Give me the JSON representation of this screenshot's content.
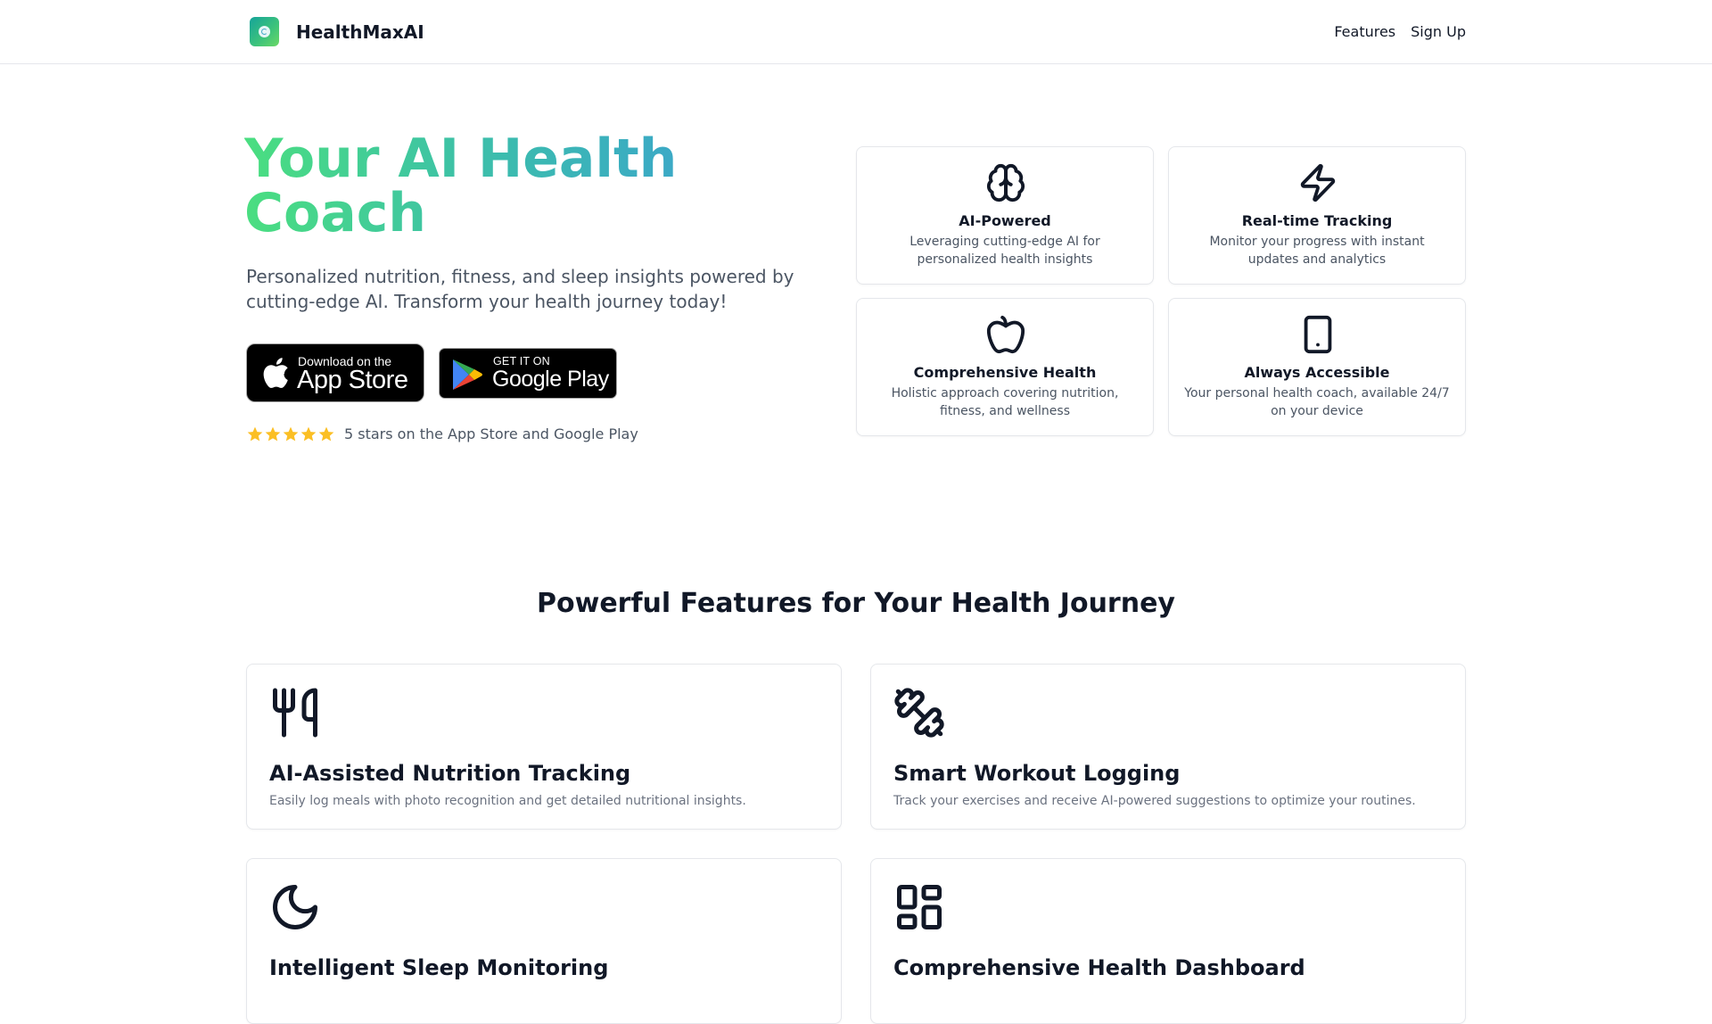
{
  "header": {
    "brand": "HealthMaxAI",
    "nav": [
      {
        "label": "Features"
      },
      {
        "label": "Sign Up"
      }
    ]
  },
  "hero": {
    "title": "Your AI Health Coach",
    "subtitle": "Personalized nutrition, fitness, and sleep insights powered by cutting-edge AI. Transform your health journey today!",
    "app_store": {
      "small": "Download on the",
      "big": "App Store"
    },
    "google_play": {
      "small": "GET IT ON",
      "big": "Google Play"
    },
    "rating": {
      "stars": 5,
      "max_stars": 5,
      "text": "5 stars on the App Store and Google Play",
      "star_color": "#fbbf24"
    }
  },
  "highlights": [
    {
      "icon": "brain-icon",
      "title": "AI-Powered",
      "description": "Leveraging cutting-edge AI for personalized health insights"
    },
    {
      "icon": "lightning-icon",
      "title": "Real-time Tracking",
      "description": "Monitor your progress with instant updates and analytics"
    },
    {
      "icon": "apple-icon",
      "title": "Comprehensive Health",
      "description": "Holistic approach covering nutrition, fitness, and wellness"
    },
    {
      "icon": "smartphone-icon",
      "title": "Always Accessible",
      "description": "Your personal health coach, available 24/7 on your device"
    }
  ],
  "features": {
    "title": "Powerful Features for Your Health Journey",
    "items": [
      {
        "icon": "utensils-icon",
        "title": "AI-Assisted Nutrition Tracking",
        "description": "Easily log meals with photo recognition and get detailed nutritional insights."
      },
      {
        "icon": "dumbbell-icon",
        "title": "Smart Workout Logging",
        "description": "Track your exercises and receive AI-powered suggestions to optimize your routines."
      },
      {
        "icon": "moon-icon",
        "title": "Intelligent Sleep Monitoring",
        "description": ""
      },
      {
        "icon": "dashboard-icon",
        "title": "Comprehensive Health Dashboard",
        "description": ""
      }
    ]
  },
  "colors": {
    "gradient_start": "#4ade80",
    "gradient_end": "#3b9ad9",
    "text_primary": "#111827",
    "text_secondary": "#4b5563",
    "border": "#e5e7eb"
  }
}
